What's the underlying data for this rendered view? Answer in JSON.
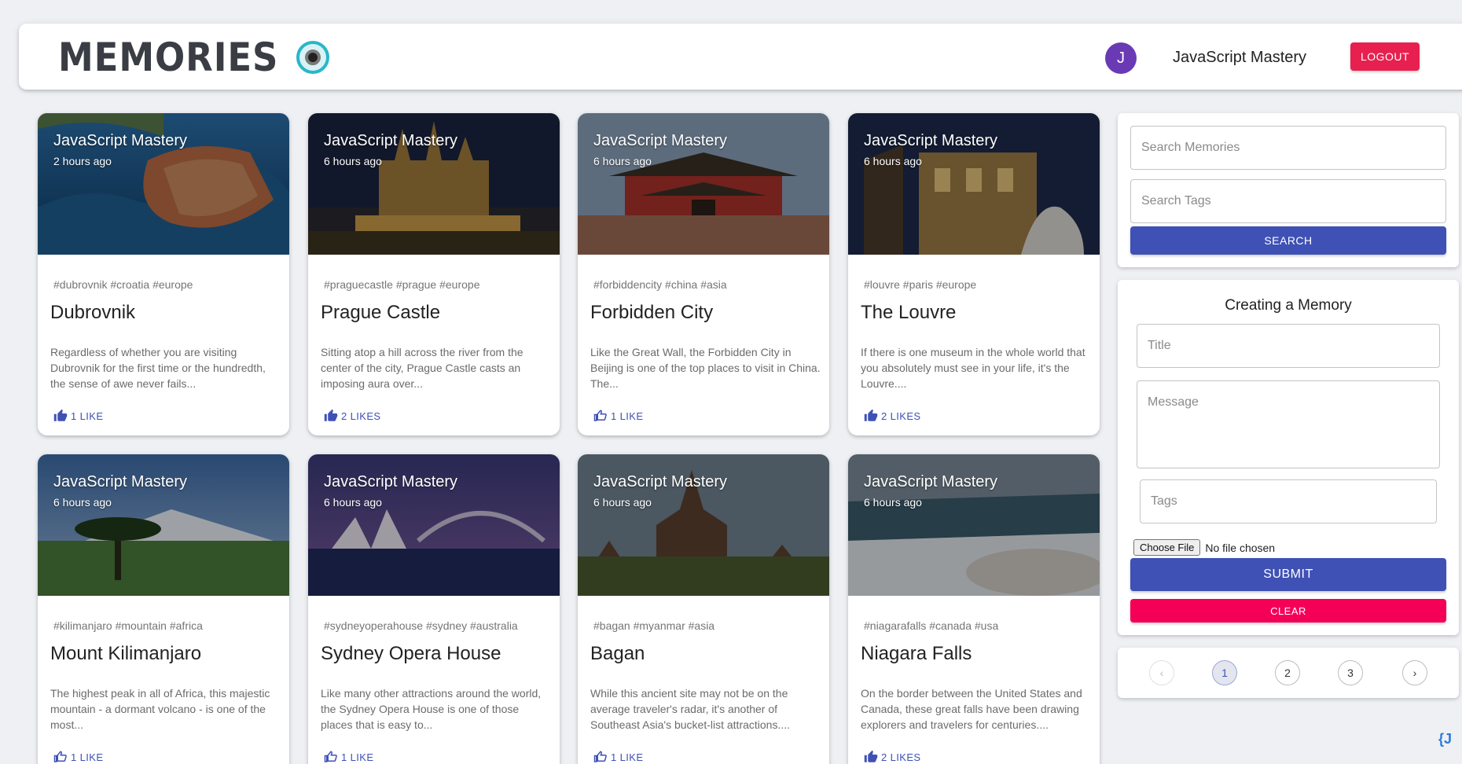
{
  "header": {
    "brand": "MEMORIES",
    "user_initial": "J",
    "user_name": "JavaScript Mastery",
    "logout_label": "LOGOUT"
  },
  "posts": [
    {
      "author": "JavaScript Mastery",
      "time": "2 hours ago",
      "tags": "#dubrovnik #croatia #europe",
      "title": "Dubrovnik",
      "message": "Regardless of whether you are visiting Dubrovnik for the first time or the hundredth, the sense of awe never fails...",
      "likes": "1 LIKE"
    },
    {
      "author": "JavaScript Mastery",
      "time": "6 hours ago",
      "tags": "#praguecastle #prague #europe",
      "title": "Prague Castle",
      "message": "Sitting atop a hill across the river from the center of the city, Prague Castle casts an imposing aura over...",
      "likes": "2 LIKES"
    },
    {
      "author": "JavaScript Mastery",
      "time": "6 hours ago",
      "tags": "#forbiddencity #china #asia",
      "title": "Forbidden City",
      "message": "Like the Great Wall, the Forbidden City in Beijing is one of the top places to visit in China. The...",
      "likes": "1 LIKE"
    },
    {
      "author": "JavaScript Mastery",
      "time": "6 hours ago",
      "tags": "#louvre #paris #europe",
      "title": "The Louvre",
      "message": "If there is one museum in the whole world that you absolutely must see in your life, it's the Louvre....",
      "likes": "2 LIKES"
    },
    {
      "author": "JavaScript Mastery",
      "time": "6 hours ago",
      "tags": "#kilimanjaro #mountain #africa",
      "title": "Mount Kilimanjaro",
      "message": "The highest peak in all of Africa, this majestic mountain - a dormant volcano - is one of the most...",
      "likes": "1 LIKE"
    },
    {
      "author": "JavaScript Mastery",
      "time": "6 hours ago",
      "tags": "#sydneyoperahouse #sydney #australia",
      "title": "Sydney Opera House",
      "message": "Like many other attractions around the world, the Sydney Opera House is one of those places that is easy to...",
      "likes": "1 LIKE"
    },
    {
      "author": "JavaScript Mastery",
      "time": "6 hours ago",
      "tags": "#bagan #myanmar #asia",
      "title": "Bagan",
      "message": "While this ancient site may not be on the average traveler's radar, it's another of Southeast Asia's bucket-list attractions....",
      "likes": "1 LIKE"
    },
    {
      "author": "JavaScript Mastery",
      "time": "6 hours ago",
      "tags": "#niagarafalls #canada #usa",
      "title": "Niagara Falls",
      "message": "On the border between the United States and Canada, these great falls have been drawing explorers and travelers for centuries....",
      "likes": "2 LIKES"
    }
  ],
  "search": {
    "memories_placeholder": "Search Memories",
    "tags_placeholder": "Search Tags",
    "button_label": "SEARCH"
  },
  "form": {
    "heading": "Creating a Memory",
    "title_placeholder": "Title",
    "message_placeholder": "Message",
    "tags_placeholder": "Tags",
    "file_button": "Choose File",
    "file_status": "No file chosen",
    "submit_label": "SUBMIT",
    "clear_label": "CLEAR"
  },
  "pagination": {
    "prev_icon": "‹",
    "pages": [
      "1",
      "2",
      "3"
    ],
    "current": "1",
    "next_icon": "›"
  },
  "colors": {
    "primary": "#3f51b5",
    "secondary": "#f50057",
    "avatar": "#6a3ab5"
  }
}
